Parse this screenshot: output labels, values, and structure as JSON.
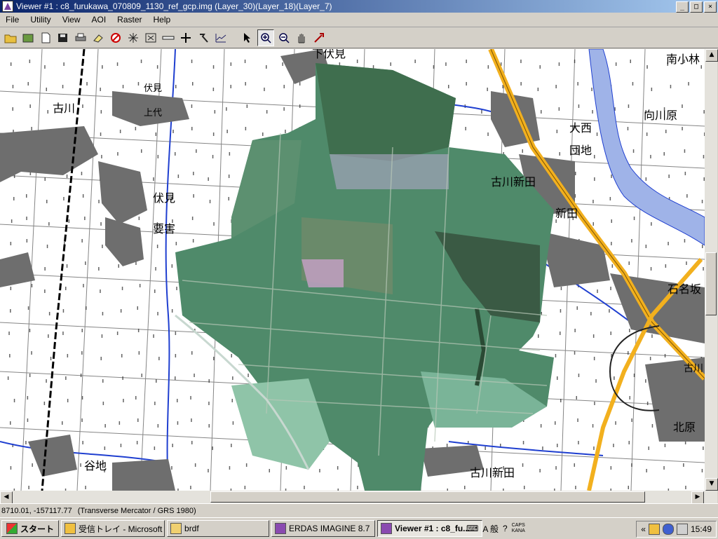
{
  "window": {
    "title": "Viewer #1 : c8_furukawa_070809_1130_ref_gcp.img (Layer_30)(Layer_18)(Layer_7)",
    "controls": {
      "minimize": "_",
      "maximize": "□",
      "close": "×"
    }
  },
  "menu": [
    "File",
    "Utility",
    "View",
    "AOI",
    "Raster",
    "Help"
  ],
  "toolbar": {
    "icons": [
      "open-folder-icon",
      "open-layer-icon",
      "new-document-icon",
      "save-icon",
      "print-icon",
      "eraser-icon",
      "close-layer-icon",
      "zoom-fit-icon",
      "zoom-extent-icon",
      "measure-ruler-icon",
      "crosshair-icon",
      "hammer-icon",
      "profile-icon",
      "select-arrow-icon",
      "zoom-in-icon",
      "zoom-out-icon",
      "pan-hand-icon",
      "inquire-icon"
    ],
    "active_tool": "zoom-in-icon"
  },
  "map": {
    "labels": [
      "下伏見",
      "古川",
      "伏見",
      "上代",
      "伏見",
      "要害",
      "古川新田",
      "新田",
      "大西",
      "団地",
      "向川原",
      "南小林",
      "石名坂",
      "北原",
      "古川新田",
      "谷地",
      "古川"
    ],
    "accent_colors": {
      "road": "#f2b01e",
      "river": "#1f3fd0",
      "town": "#6e6e6e",
      "imagery": "#4f8a6a"
    }
  },
  "status": {
    "coords": "8710.01, -157117.77",
    "projection": "(Transverse Mercator / GRS 1980)"
  },
  "taskbar": {
    "start": "スタート",
    "tasks": [
      {
        "label": "受信トレイ - Microsoft ...",
        "active": false
      },
      {
        "label": "brdf",
        "active": false
      },
      {
        "label": "ERDAS IMAGINE 8.7",
        "active": false
      },
      {
        "label": "Viewer #1 : c8_fu...",
        "active": true
      }
    ],
    "ime": {
      "mode": "A 般",
      "caps": "CAPS",
      "kana": "KANA"
    },
    "clock": "15:49"
  }
}
